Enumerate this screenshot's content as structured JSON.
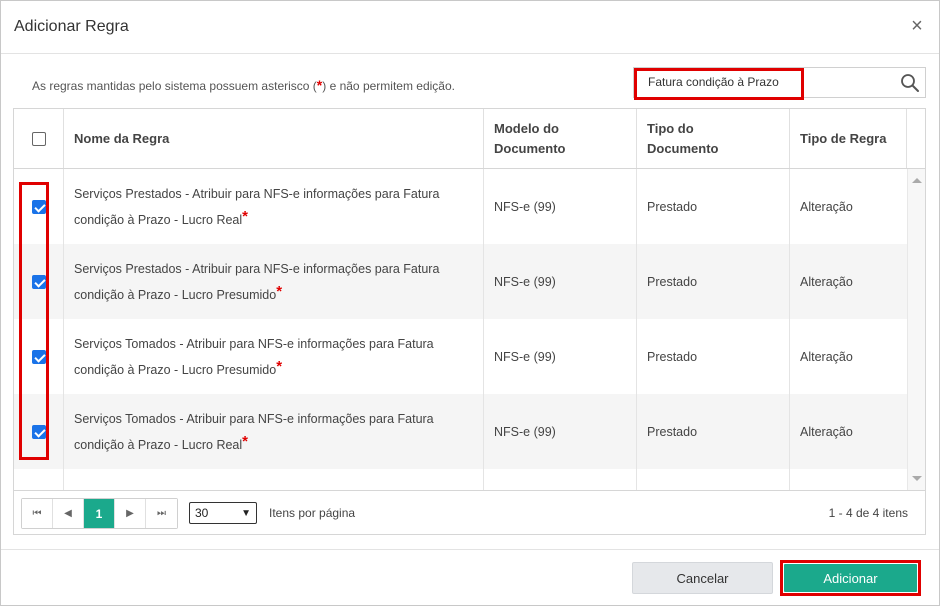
{
  "dialog": {
    "title": "Adicionar Regra",
    "close_icon": "close-icon"
  },
  "info": {
    "text_before": "As regras mantidas pelo sistema possuem asterisco (",
    "star": "*",
    "text_after": ") e não permitem edição."
  },
  "search": {
    "value": "Fatura condição à Prazo",
    "icon": "search-icon"
  },
  "grid": {
    "columns": {
      "name": "Nome da Regra",
      "model_line1": "Modelo do",
      "model_line2": "Documento",
      "type_line1": "Tipo do",
      "type_line2": "Documento",
      "rule_type": "Tipo de Regra"
    },
    "rows": [
      {
        "checked": true,
        "name_line1": "Serviços Prestados - Atribuir para NFS-e informações para Fatura",
        "name_line2": "condição à Prazo - Lucro Real",
        "star": "*",
        "model": "NFS-e (99)",
        "doc_type": "Prestado",
        "rule_type": "Alteração"
      },
      {
        "checked": true,
        "name_line1": "Serviços Prestados - Atribuir para NFS-e informações para Fatura",
        "name_line2": "condição à Prazo - Lucro Presumido",
        "star": "*",
        "model": "NFS-e (99)",
        "doc_type": "Prestado",
        "rule_type": "Alteração"
      },
      {
        "checked": true,
        "name_line1": "Serviços Tomados - Atribuir para NFS-e informações para Fatura",
        "name_line2": "condição à Prazo - Lucro Presumido",
        "star": "*",
        "model": "NFS-e (99)",
        "doc_type": "Prestado",
        "rule_type": "Alteração"
      },
      {
        "checked": true,
        "name_line1": "Serviços Tomados - Atribuir para NFS-e informações para Fatura",
        "name_line2": "condição à Prazo - Lucro Real",
        "star": "*",
        "model": "NFS-e (99)",
        "doc_type": "Prestado",
        "rule_type": "Alteração"
      }
    ]
  },
  "pager": {
    "current_page": "1",
    "page_size": "30",
    "page_size_label": "Itens por página",
    "count_text": "1 - 4 de 4 itens"
  },
  "footer": {
    "cancel_label": "Cancelar",
    "add_label": "Adicionar"
  },
  "colors": {
    "accent": "#1ba98c",
    "highlight": "#e00000",
    "checkbox": "#1a73e8"
  }
}
